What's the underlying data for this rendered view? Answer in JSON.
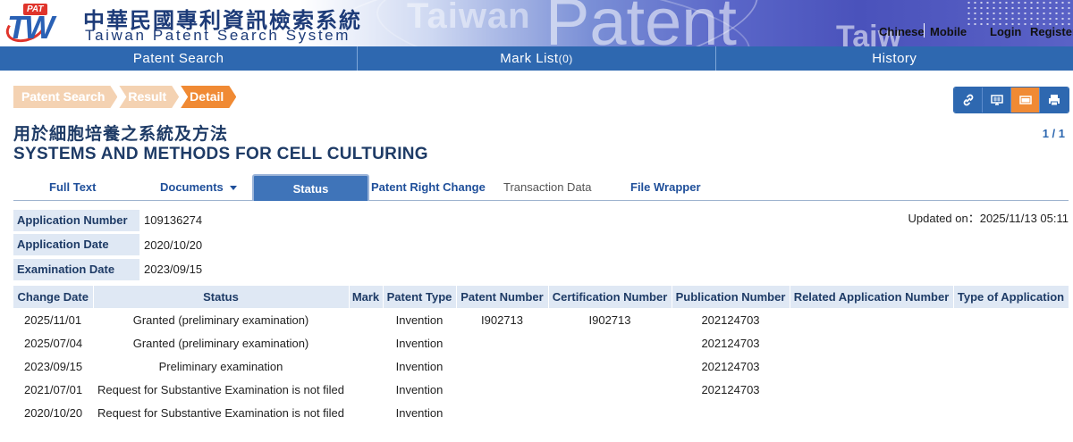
{
  "header": {
    "logo_badge": "PAT",
    "logo_mark": "TW",
    "title_cn": "中華民國專利資訊檢索系統",
    "title_en": "Taiwan Patent Search System",
    "watermark_1": "Taiwan",
    "watermark_2": "Patent",
    "watermark_3": "Taiw",
    "links": {
      "chinese": "Chinese",
      "mobile": "Mobile",
      "login": "Login",
      "register": "Register"
    }
  },
  "nav": {
    "patent_search": "Patent Search",
    "mark_list": "Mark List",
    "mark_list_count": "(0)",
    "history": "History"
  },
  "breadcrumb": [
    "Patent Search",
    "Result",
    "Detail"
  ],
  "tools": [
    "link-icon",
    "monitor-icon",
    "window-icon",
    "print-icon"
  ],
  "patent": {
    "title_cn": "用於細胞培養之系統及方法",
    "title_en": "SYSTEMS AND METHODS FOR CELL CULTURING",
    "pager": "1 / 1"
  },
  "tabs": {
    "full_text": "Full Text",
    "documents": "Documents",
    "status": "Status",
    "patent_right_change": "Patent Right Change",
    "transaction_data": "Transaction Data",
    "file_wrapper": "File Wrapper"
  },
  "info": {
    "app_number_label": "Application Number",
    "app_number": "109136274",
    "app_date_label": "Application Date",
    "app_date": "2020/10/20",
    "exam_date_label": "Examination Date",
    "exam_date": "2023/09/15",
    "updated": "Updated on：2025/11/13 05:11"
  },
  "table": {
    "headers": [
      "Change Date",
      "Status",
      "Mark",
      "Patent Type",
      "Patent Number",
      "Certification Number",
      "Publication Number",
      "Related Application Number",
      "Type of Application"
    ],
    "rows": [
      [
        "2025/11/01",
        "Granted (preliminary examination)",
        "",
        "Invention",
        "I902713",
        "I902713",
        "202124703",
        "",
        ""
      ],
      [
        "2025/07/04",
        "Granted (preliminary examination)",
        "",
        "Invention",
        "",
        "",
        "202124703",
        "",
        ""
      ],
      [
        "2023/09/15",
        "Preliminary examination",
        "",
        "Invention",
        "",
        "",
        "202124703",
        "",
        ""
      ],
      [
        "2021/07/01",
        "Request for Substantive Examination is not filed",
        "",
        "Invention",
        "",
        "",
        "202124703",
        "",
        ""
      ],
      [
        "2020/10/20",
        "Request for Substantive Examination is not filed",
        "",
        "Invention",
        "",
        "",
        "",
        "",
        ""
      ]
    ]
  }
}
